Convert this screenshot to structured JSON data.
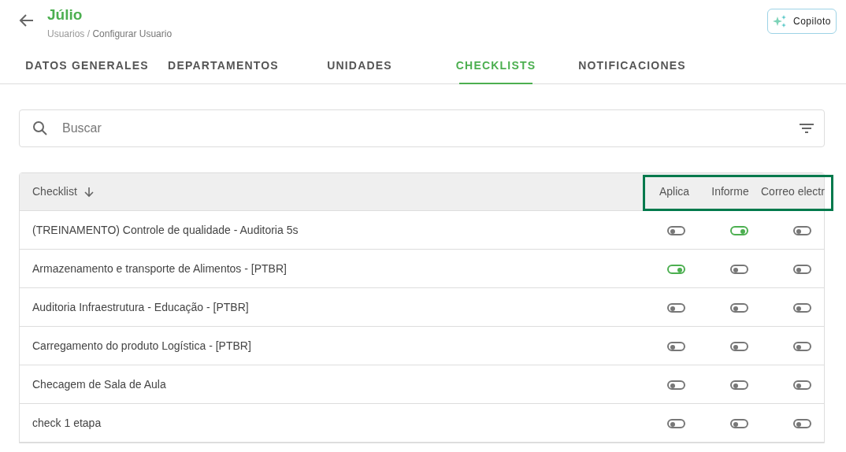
{
  "header": {
    "title": "Júlio",
    "breadcrumb": [
      "Usuarios /",
      "Configurar Usuario"
    ],
    "copilot_button": "Copiloto"
  },
  "tabs": [
    {
      "label": "DATOS GENERALES",
      "selected": false
    },
    {
      "label": "DEPARTAMENTOS",
      "selected": false
    },
    {
      "label": "UNIDADES",
      "selected": false
    },
    {
      "label": "CHECKLISTS",
      "selected": true
    },
    {
      "label": "NOTIFICACIONES",
      "selected": false
    }
  ],
  "search": {
    "placeholder": "Buscar"
  },
  "table": {
    "columns": [
      "Checklist",
      "Aplica",
      "Informe",
      "Correo electr"
    ],
    "highlighted_columns": true,
    "rows": [
      {
        "name": "(TREINAMENTO) Controle de qualidade - Auditoria 5s",
        "aplica": false,
        "informe": true,
        "correo": false
      },
      {
        "name": "Armazenamento e transporte de Alimentos - [PTBR]",
        "aplica": true,
        "informe": false,
        "correo": false
      },
      {
        "name": "Auditoria Infraestrutura - Educação - [PTBR]",
        "aplica": false,
        "informe": false,
        "correo": false
      },
      {
        "name": "Carregamento do produto Logística - [PTBR]",
        "aplica": false,
        "informe": false,
        "correo": false
      },
      {
        "name": "Checagem de Sala de Aula",
        "aplica": false,
        "informe": false,
        "correo": false
      },
      {
        "name": "check 1 etapa",
        "aplica": false,
        "informe": false,
        "correo": false
      }
    ]
  }
}
